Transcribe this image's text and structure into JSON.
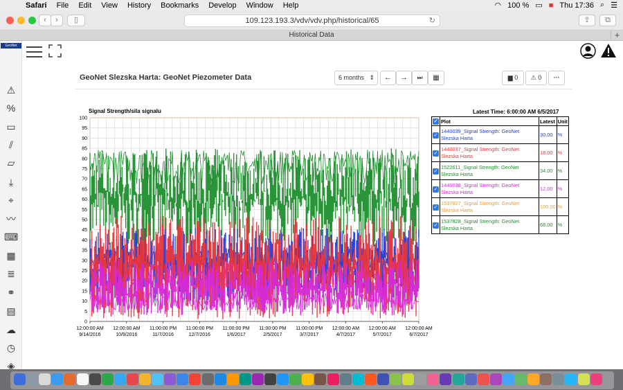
{
  "menubar": {
    "app": "Safari",
    "items": [
      "File",
      "Edit",
      "View",
      "History",
      "Bookmarks",
      "Develop",
      "Window",
      "Help"
    ],
    "battery": "100 %",
    "clock": "Thu 17:36"
  },
  "browser": {
    "url": "109.123.193.3/vdv/vdv.php/historical/65",
    "tab_title": "Historical Data"
  },
  "app": {
    "logo": "GeoNet",
    "page_title": "GeoNet Slezska Harta: GeoNet Piezometer Data",
    "range_select": "6 months",
    "comments_count": "0",
    "alerts_count": "0",
    "more_label": "···"
  },
  "chart_header": {
    "title": "Signal Strength/sila signalu",
    "latest_time": "Latest Time: 6:00:00 AM 6/5/2017"
  },
  "legend": {
    "headers": [
      "Plot",
      "Latest",
      "Unit"
    ],
    "rows": [
      {
        "plot": "1440039_Signal Strength: GeoNet Slezska Harta",
        "latest": "30.00",
        "unit": "%",
        "color": "#1f3fd6"
      },
      {
        "plot": "1440037_Signal Strength: GeoNet Slezska Harta",
        "latest": "18.00",
        "unit": "%",
        "color": "#e8353b"
      },
      {
        "plot": "1522611_Signal Strength: GeoNet Slezska Harta",
        "latest": "34.00",
        "unit": "%",
        "color": "#1e8f2d"
      },
      {
        "plot": "1440038_Signal Strength: GeoNet Slezska Harta",
        "latest": "12.00",
        "unit": "%",
        "color": "#d52ad8"
      },
      {
        "plot": "1537827_Signal Strength: GeoNet Slezska Harta",
        "latest": "100.00",
        "unit": "%",
        "color": "#f39b2e"
      },
      {
        "plot": "1537828_Signal Strength: GeoNet Slezska Harta",
        "latest": "68.00",
        "unit": "%",
        "color": "#1e8f2d"
      }
    ]
  },
  "chart_data": {
    "type": "line",
    "ylim": [
      0,
      100
    ],
    "yticks": [
      0,
      5,
      10,
      15,
      20,
      25,
      30,
      35,
      40,
      45,
      50,
      55,
      60,
      65,
      70,
      75,
      80,
      85,
      90,
      95,
      100
    ],
    "x_tick_labels": [
      [
        "12:00:00 AM",
        "9/14/2016"
      ],
      [
        "12:00:00 AM",
        "10/9/2016"
      ],
      [
        "11:00:00 PM",
        "11/7/2016"
      ],
      [
        "11:00:00 PM",
        "12/7/2016"
      ],
      [
        "11:00:00 PM",
        "1/6/2017"
      ],
      [
        "11:00:00 PM",
        "2/5/2017"
      ],
      [
        "11:00:00 PM",
        "3/7/2017"
      ],
      [
        "12:00:00 AM",
        "4/7/2017"
      ],
      [
        "12:00:00 AM",
        "5/7/2017"
      ],
      [
        "12:00:00 AM",
        "6/7/2017"
      ]
    ],
    "x_range": [
      "9/14/2016",
      "6/7/2017"
    ],
    "grid": true,
    "series": [
      {
        "name": "1522611_Signal Strength: GeoNet Slezska Harta",
        "color": "#1e8f2d",
        "band": [
          36,
          85
        ],
        "typical": 76
      },
      {
        "name": "1440039_Signal Strength: GeoNet Slezska Harta",
        "color": "#1f3fd6",
        "band": [
          10,
          46
        ],
        "typical": 30
      },
      {
        "name": "1440037_Signal Strength: GeoNet Slezska Harta",
        "color": "#e8353b",
        "band": [
          1,
          52
        ],
        "typical": 25
      },
      {
        "name": "1440038_Signal Strength: GeoNet Slezska Harta",
        "color": "#d52ad8",
        "band": [
          3,
          30
        ],
        "typical": 10
      }
    ]
  }
}
